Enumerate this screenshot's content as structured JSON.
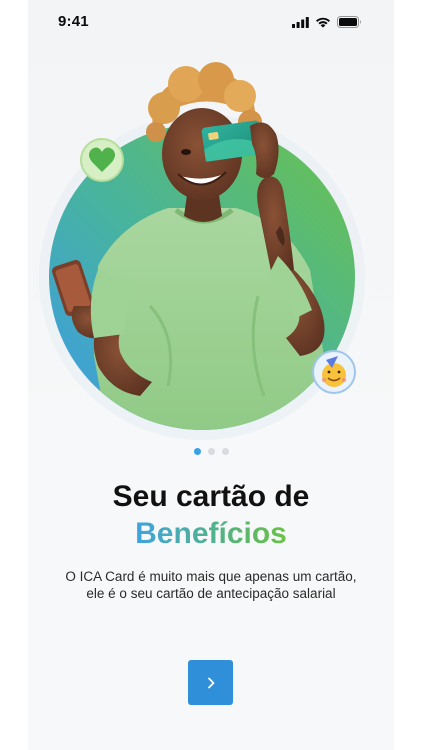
{
  "status_bar": {
    "time": "9:41",
    "icons": [
      "signal-icon",
      "wifi-icon",
      "battery-icon"
    ]
  },
  "hero": {
    "image": "woman-holding-card-and-phone",
    "badges": [
      "green-heart-emoji",
      "party-face-emoji"
    ]
  },
  "pagination": {
    "total": 3,
    "active_index": 0
  },
  "onboarding": {
    "title": "Seu cartão de",
    "title_accent": "Benefícios",
    "description": "O ICA Card é muito mais que apenas um cartão, ele é o seu cartão de antecipação salarial",
    "next_button_icon": "chevron-right-icon"
  },
  "colors": {
    "primary": "#2f8fd8",
    "gradient_start": "#3fa3e0",
    "gradient_end": "#6cc24a",
    "dot_active": "#3aa0e6",
    "dot_inactive": "#d8dbe0"
  }
}
